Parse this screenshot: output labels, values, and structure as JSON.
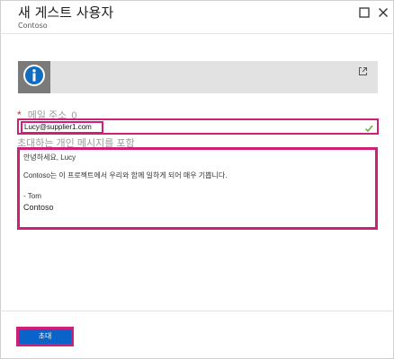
{
  "header": {
    "title": "새 게스트 사용자",
    "subtitle": "Contoso"
  },
  "window": {
    "maximize_icon": "maximize-icon",
    "close_icon": "close-icon"
  },
  "banner": {
    "icon": "info-icon",
    "link_icon": "external-link-icon"
  },
  "email": {
    "label": "메일 주소",
    "required_marker": "*",
    "info_marker": "0",
    "value": "Lucy@supplier1.com",
    "status_icon": "checkmark-icon"
  },
  "message": {
    "label": "초대하는 개인 메시지를 포함",
    "lines": [
      "안녕하세요, Lucy",
      "Contoso는 이 프로젝트에서 우리와 함께 일하게 되어 매우 기쁩니다.",
      "- Tom",
      "Contoso"
    ]
  },
  "footer": {
    "invite_label": "초대"
  },
  "colors": {
    "highlight": "#cf1f78",
    "primary_button": "#0a63c8",
    "banner_bg": "#e2e2e2",
    "banner_icon_bg": "#7a7a7a",
    "required": "#c0392b",
    "success": "#5fae35"
  }
}
